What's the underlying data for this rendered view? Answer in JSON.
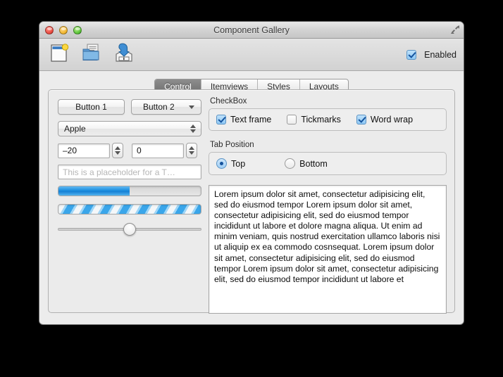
{
  "window": {
    "title": "Component Gallery",
    "traffic_lights": [
      "close-button",
      "minimize-button",
      "zoom-button"
    ],
    "resize_grip_icon": "resize-arrows-icon"
  },
  "toolbar": {
    "items": [
      {
        "name": "new-document-button",
        "icon": "new-document-icon"
      },
      {
        "name": "open-folder-button",
        "icon": "open-folder-icon"
      },
      {
        "name": "save-button",
        "icon": "save-to-disk-icon"
      }
    ],
    "enabled_checkbox": {
      "label": "Enabled",
      "checked": true
    }
  },
  "tabs": {
    "items": [
      {
        "label": "Control",
        "selected": true
      },
      {
        "label": "Itemviews",
        "selected": false
      },
      {
        "label": "Styles",
        "selected": false
      },
      {
        "label": "Layouts",
        "selected": false
      }
    ]
  },
  "left_column": {
    "button1": "Button 1",
    "button2": "Button 2",
    "combo_value": "Apple",
    "spin1_value": "–20",
    "spin2_value": "0",
    "line_edit_placeholder": "This is a placeholder for a T…",
    "line_edit_value": "",
    "progress_value": 50,
    "progress_busy_label": "indeterminate",
    "slider_value": 50
  },
  "checkbox_group": {
    "title": "CheckBox",
    "items": [
      {
        "label": "Text frame",
        "checked": true
      },
      {
        "label": "Tickmarks",
        "checked": false
      },
      {
        "label": "Word wrap",
        "checked": true
      }
    ]
  },
  "tab_position_group": {
    "title": "Tab Position",
    "items": [
      {
        "label": "Top",
        "selected": true
      },
      {
        "label": "Bottom",
        "selected": false
      }
    ]
  },
  "text_area": {
    "content": "Lorem ipsum dolor sit amet, consectetur adipisicing elit, sed do eiusmod tempor Lorem ipsum dolor sit amet, consectetur adipisicing elit, sed do eiusmod tempor incididunt ut labore et dolore magna aliqua. Ut enim ad minim veniam, quis nostrud exercitation ullamco laboris nisi ut aliquip ex ea commodo cosnsequat. Lorem ipsum dolor sit amet, consectetur adipisicing elit, sed do eiusmod tempor Lorem ipsum dolor sit amet, consectetur adipisicing elit, sed do eiusmod tempor incididunt ut labore et"
  },
  "colors": {
    "accent_blue": "#1b8ee0",
    "window_bg": "#ececec",
    "selected_tab": "#7b7b7b",
    "traffic_red": "#e8463b",
    "traffic_yellow": "#f0b429",
    "traffic_green": "#54c033"
  }
}
